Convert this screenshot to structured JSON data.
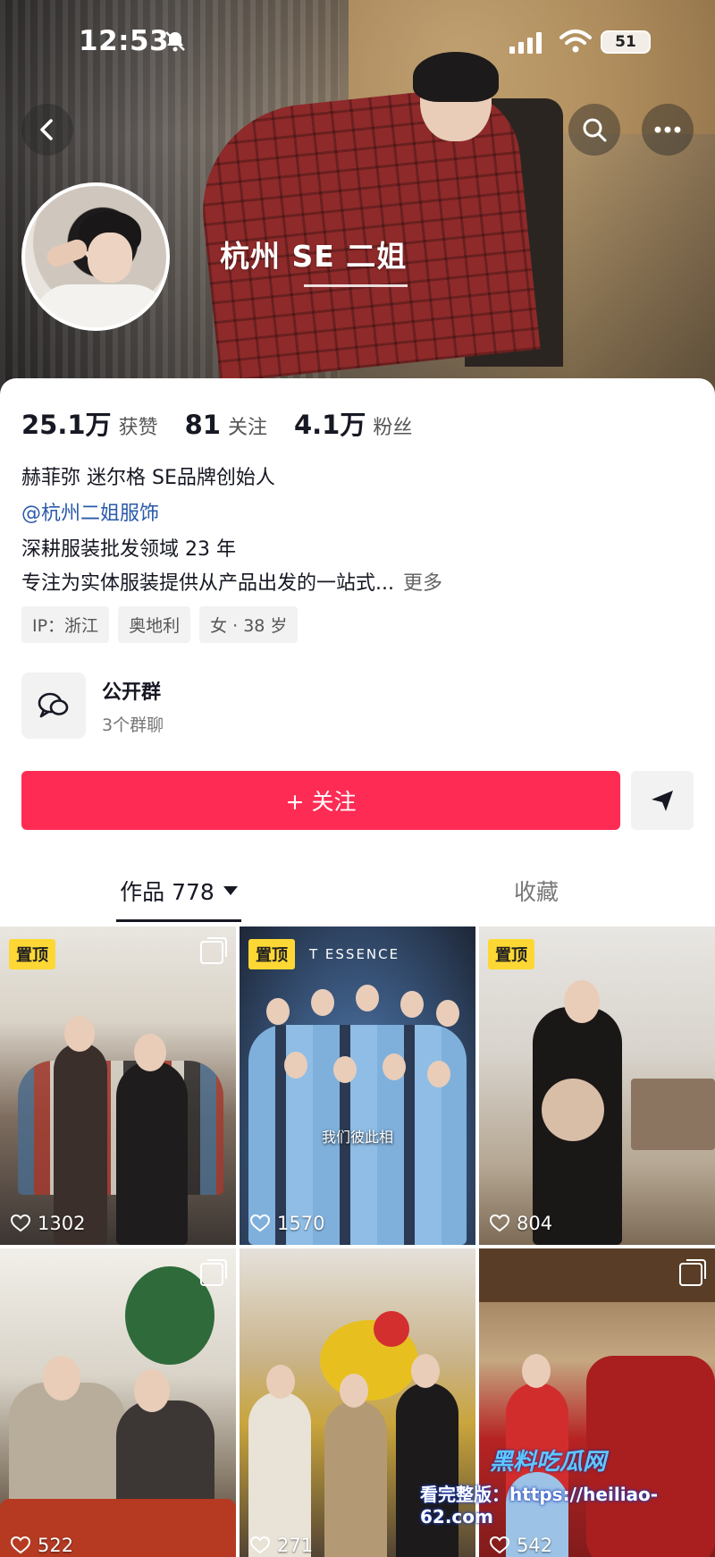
{
  "status_bar": {
    "time": "12:53",
    "battery": "51"
  },
  "profile": {
    "name": "杭州 SE 二姐",
    "stats": [
      {
        "value": "25.1万",
        "label": "获赞"
      },
      {
        "value": "81",
        "label": "关注"
      },
      {
        "value": "4.1万",
        "label": "粉丝"
      }
    ],
    "bio": {
      "line1": "赫菲弥 迷尔格 SE品牌创始人",
      "mention": "@杭州二姐服饰",
      "line3": "深耕服装批发领域 23 年",
      "line4": "专注为实体服装提供从产品出发的一站式...",
      "more": "更多"
    },
    "tags": [
      "IP：浙江",
      "奥地利",
      "女 · 38 岁"
    ]
  },
  "group": {
    "title": "公开群",
    "subtitle": "3个群聊"
  },
  "actions": {
    "follow_label": "+ 关注"
  },
  "tabs": {
    "works": "作品 778",
    "favorites": "收藏"
  },
  "tiles": [
    {
      "pinned": "置顶",
      "likes": "1302",
      "multi": true
    },
    {
      "pinned": "置顶",
      "likes": "1570",
      "multi": false,
      "overlay_text": "T ESSENCE",
      "caption": "我们彼此相"
    },
    {
      "pinned": "置顶",
      "likes": "804",
      "multi": false
    },
    {
      "pinned": "",
      "likes": "522",
      "multi": true
    },
    {
      "pinned": "",
      "likes": "271",
      "multi": false
    },
    {
      "pinned": "",
      "likes": "542",
      "multi": true
    }
  ],
  "watermark": {
    "brand": "黑料吃瓜网",
    "text": "看完整版：https://heiliao-62.com"
  },
  "colors": {
    "accent": "#fe2c55",
    "pin": "#fdd835",
    "link": "#2a5aa8"
  }
}
